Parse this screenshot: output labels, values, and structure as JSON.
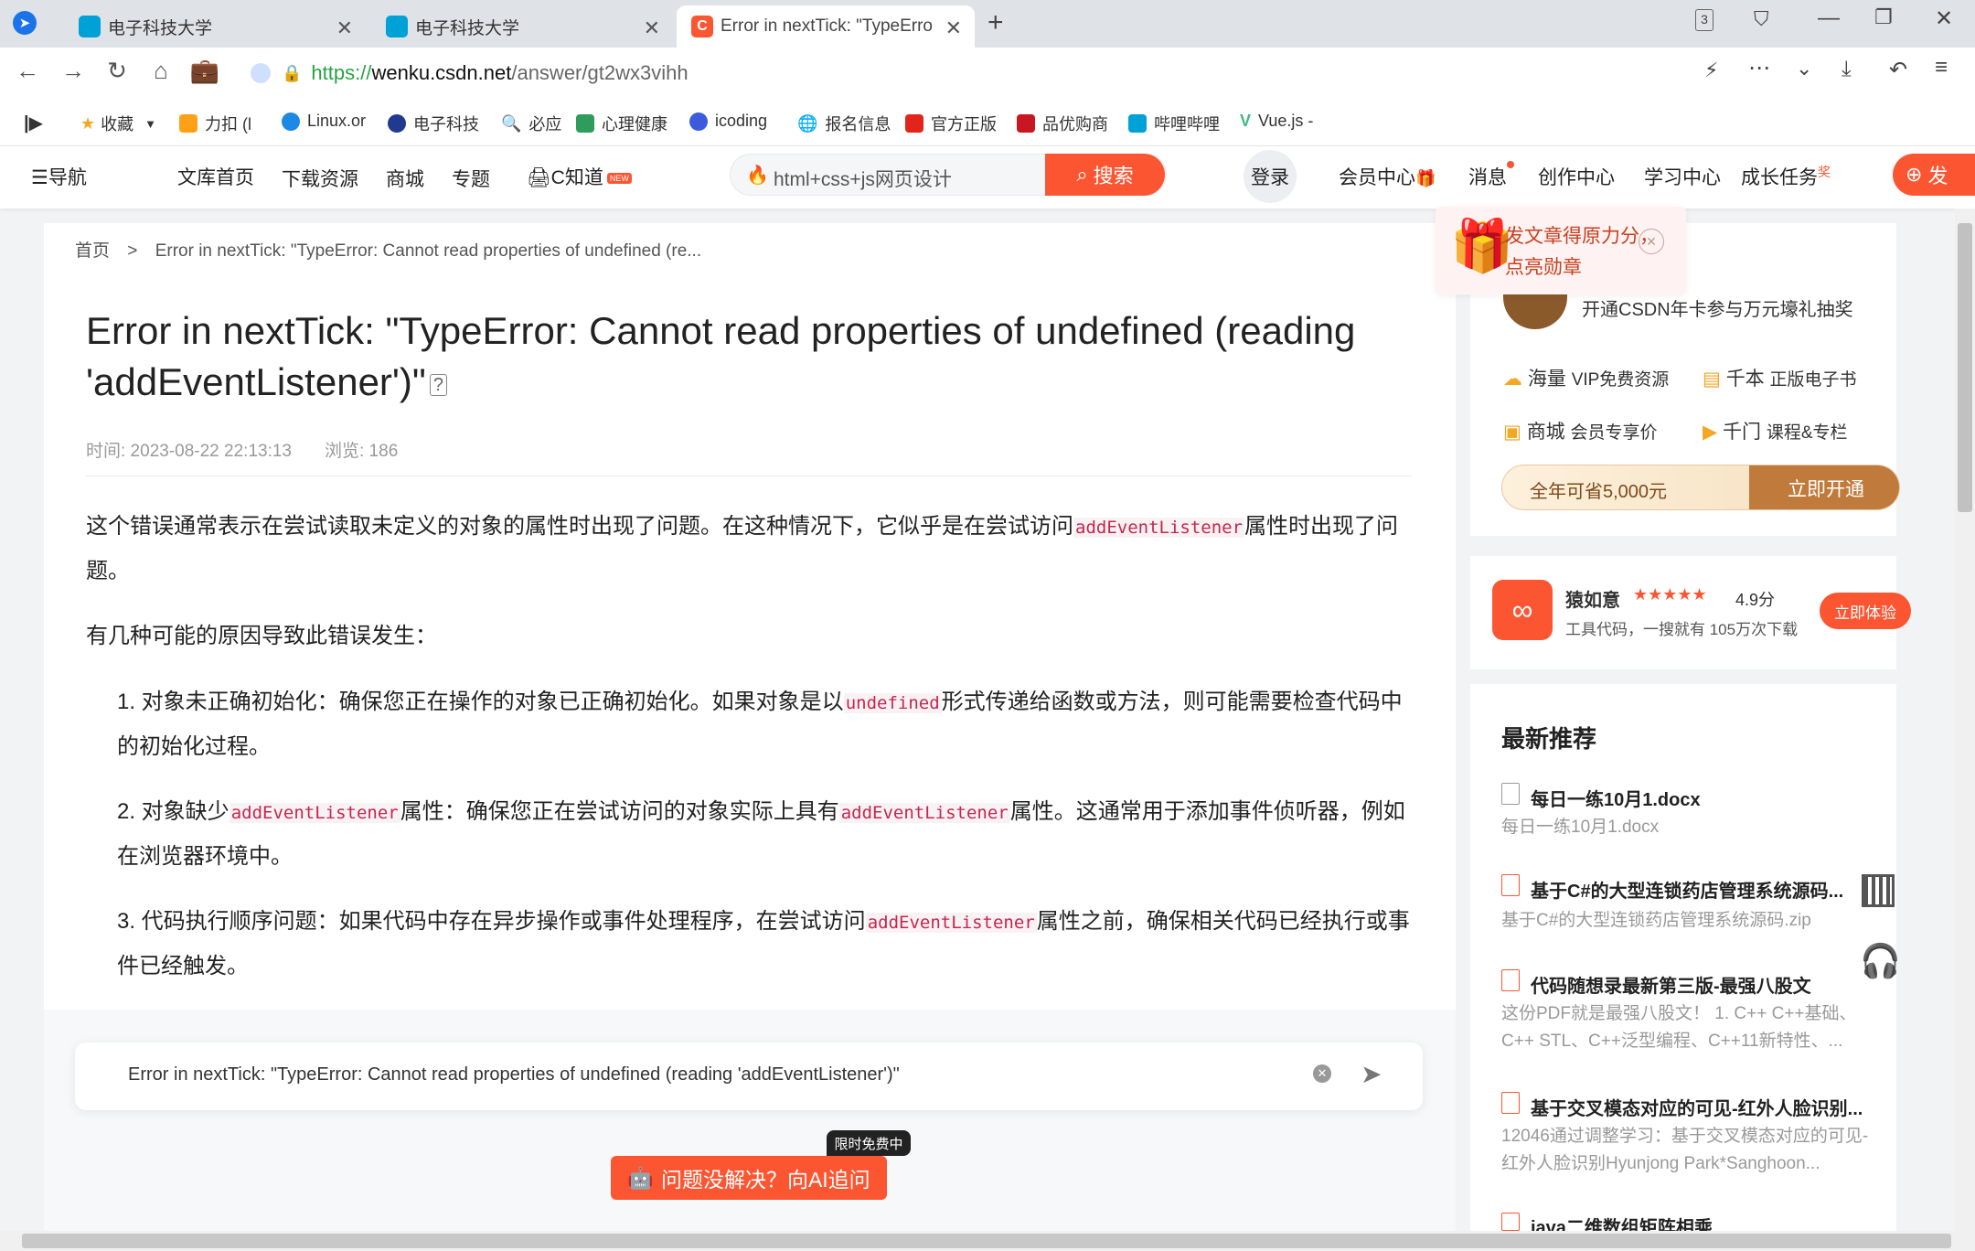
{
  "browser": {
    "tabs": [
      {
        "label": "电子科技大学"
      },
      {
        "label": "电子科技大学"
      },
      {
        "label": "Error in nextTick: \"TypeErro"
      }
    ],
    "tab_counter": "3",
    "url_scheme": "https://",
    "url_host": "wenku.csdn.net",
    "url_path": "/answer/gt2wx3vihh",
    "bookmarks": [
      "收藏",
      "力扣 (l",
      "Linux.or",
      "电子科技",
      "必应",
      "心理健康",
      "icoding",
      "报名信息",
      "官方正版",
      "品优购商",
      "哔哩哔哩",
      "Vue.js -"
    ]
  },
  "toolbar": {
    "nav": "导航",
    "items": [
      "文库首页",
      "下载资源",
      "商城",
      "专题"
    ],
    "czhidao": "C知道",
    "new_badge": "NEW",
    "search_placeholder": "html+css+js网页设计",
    "search_btn": "搜索",
    "login": "登录",
    "right": [
      "会员中心",
      "消息",
      "创作中心",
      "学习中心",
      "成长任务"
    ],
    "badge_right": "奖",
    "publish": "发"
  },
  "article": {
    "breadcrumb_home": "首页",
    "breadcrumb_sep": ">",
    "breadcrumb_current": "Error in nextTick: \"TypeError: Cannot read properties of undefined (re...",
    "title": "Error in nextTick: \"TypeError: Cannot read properties of undefined (reading 'addEventListener')\"",
    "time_label": "时间: 2023-08-22 22:13:13",
    "views_label": "浏览: 186",
    "p1a": "这个错误通常表示在尝试读取未定义的对象的属性时出现了问题。在这种情况下，它似乎是在尝试访问",
    "p1code": "addEventListener",
    "p1b": "属性时出现了问题。",
    "p2": "有几种可能的原因导致此错误发生：",
    "li1a": "1. 对象未正确初始化：确保您正在操作的对象已正确初始化。如果对象是以",
    "li1code": "undefined",
    "li1b": "形式传递给函数或方法，则可能需要检查代码中的初始化过程。",
    "li2a": "2. 对象缺少",
    "li2code1": "addEventListener",
    "li2b": "属性：确保您正在尝试访问的对象实际上具有",
    "li2code2": "addEventListener",
    "li2c": "属性。这通常用于添加事件侦听器，例如在浏览器环境中。",
    "li3a": "3. 代码执行顺序问题：如果代码中存在异步操作或事件处理程序，在尝试访问",
    "li3code": "addEventListener",
    "li3b": "属性之前，确保相关代码已经执行或事件已经触发。",
    "ask_query": "Error in nextTick: \"TypeError: Cannot read properties of undefined (reading 'addEventListener')\"",
    "ask_ai": "问题没解决？向AI追问",
    "free_badge": "限时免费中"
  },
  "sidebar": {
    "popup_line1": "发文章得原力分，",
    "popup_line2": "点亮勋章",
    "vip_text": "开通CSDN年卡参与万元壕礼抽奖",
    "benefits": [
      {
        "a": "海量",
        "b": "VIP免费资源"
      },
      {
        "a": "千本",
        "b": "正版电子书"
      },
      {
        "a": "商城",
        "b": "会员专享价"
      },
      {
        "a": "千门",
        "b": "课程&专栏"
      }
    ],
    "save_text": "全年可省5,000元",
    "open_btn": "立即开通",
    "app_name": "猿如意",
    "app_rating": "4.9分",
    "app_stars": "★★★★★",
    "app_desc": "工具代码，一搜就有 105万次下载",
    "app_btn": "立即体验",
    "rec_heading": "最新推荐",
    "recs": [
      {
        "title": "每日一练10月1.docx",
        "desc": "每日一练10月1.docx"
      },
      {
        "title": "基于C#的大型连锁药店管理系统源码...",
        "desc": "基于C#的大型连锁药店管理系统源码.zip"
      },
      {
        "title": "代码随想录最新第三版-最强八股文",
        "desc": "这份PDF就是最强⼋股文！ 1. C++ C++基础、C++ STL、C++泛型编程、C++11新特性、..."
      },
      {
        "title": "基于交叉模态对应的可见-红外人脸识别...",
        "desc": "12046通过调整学习：基于交叉模态对应的可见-红外人脸识别Hyunjong Park*Sanghoon..."
      },
      {
        "title": "java二维数组矩阵相乘",
        "desc": ""
      }
    ]
  }
}
